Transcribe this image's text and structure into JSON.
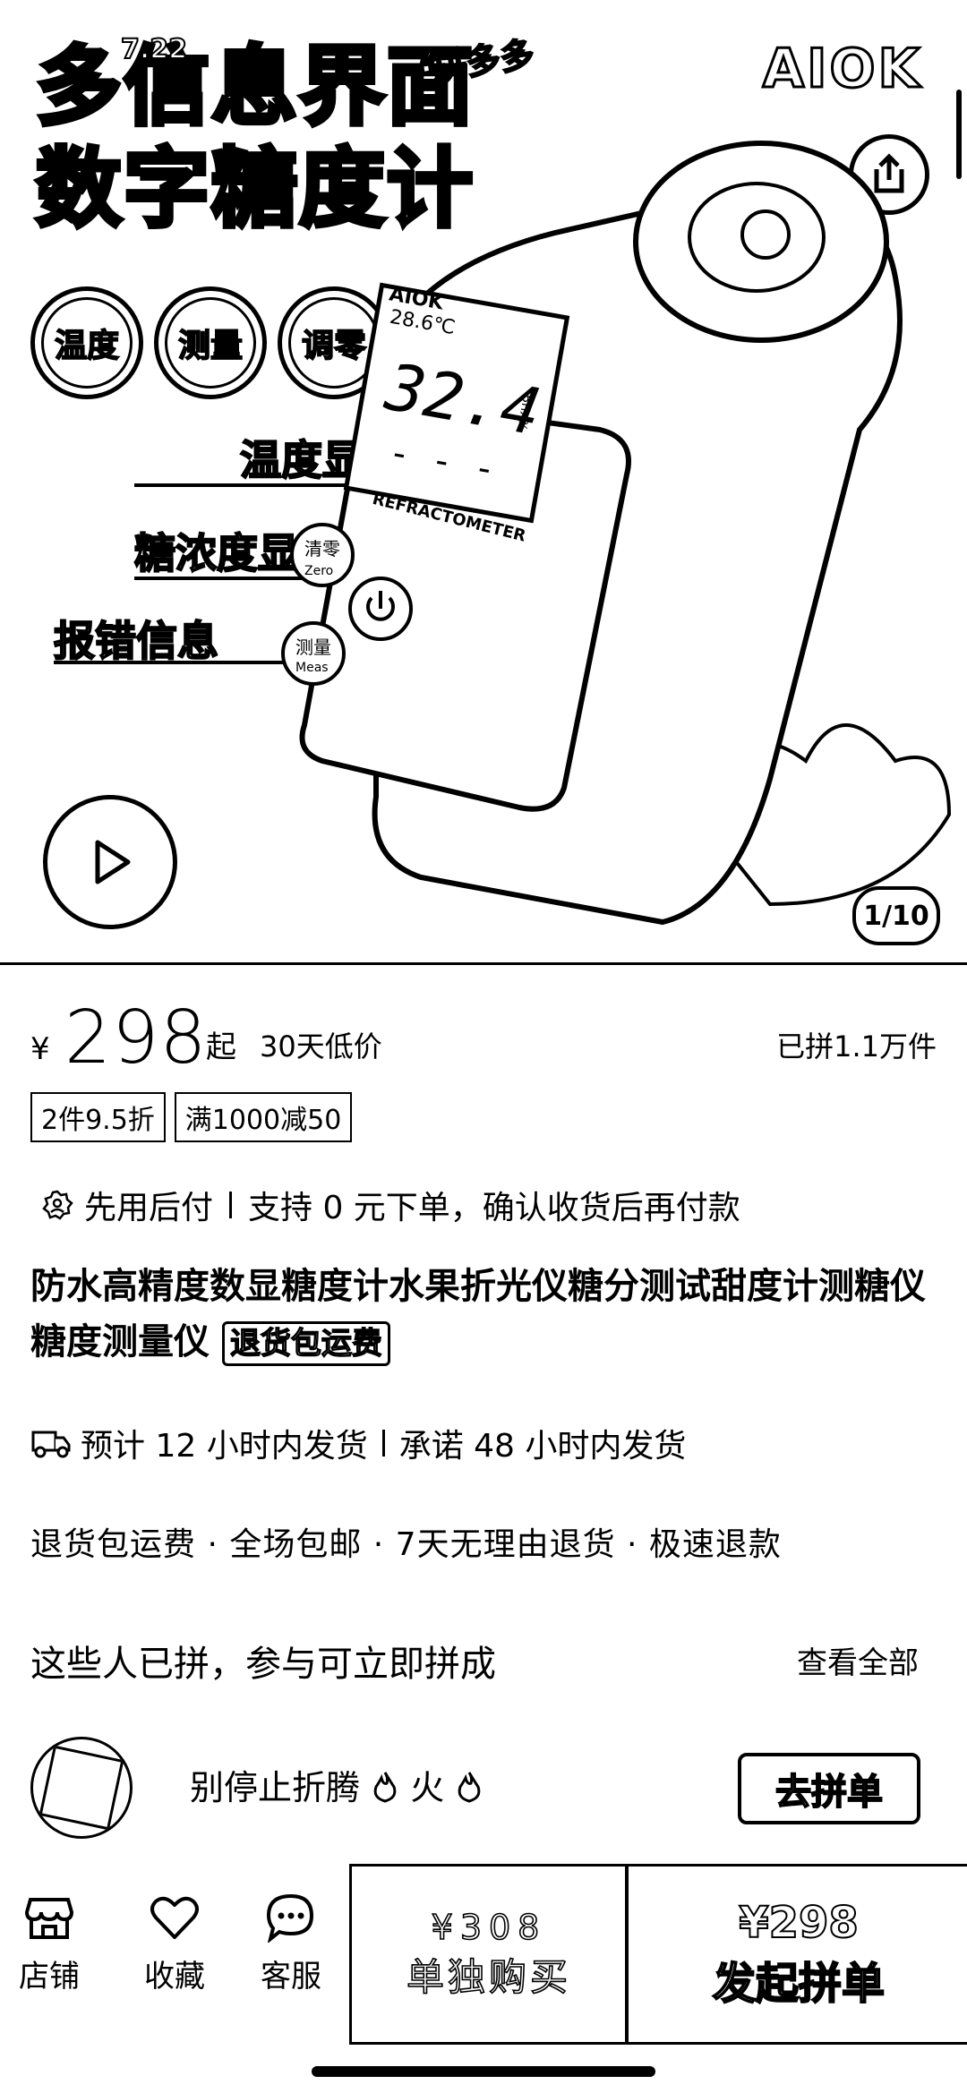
{
  "hero": {
    "title_line1": "多信息界面",
    "title_line2": "数字糖度计",
    "promo_date": "7.22",
    "platform_tag": "·拼多多",
    "brand": "AIOK",
    "features": [
      "温度",
      "测量",
      "调零"
    ],
    "callouts": [
      "温度显示",
      "糖浓度显示",
      "报错信息"
    ],
    "device": {
      "brand": "AIOK",
      "temp": "28.6℃",
      "reading": "32.4",
      "unit": "Brix%",
      "model": "REFRACTOMETER",
      "zero_label": "清零",
      "zero_sub": "Zero",
      "measure_label": "测量",
      "measure_sub": "Meas"
    },
    "pager": "1/10"
  },
  "price": {
    "currency": "¥",
    "amount": "298",
    "suffix": "起",
    "low_price_label": "30天低价",
    "sold": "已拼1.1万件"
  },
  "tags": [
    "2件9.5折",
    "满1000减50"
  ],
  "pay": {
    "title": "先用后付",
    "desc": "支持 0 元下单，确认收货后再付款"
  },
  "product": {
    "title": "防水高精度数显糖度计水果折光仪糖分测试甜度计测糖仪糖度测量仪",
    "badge": "退货包运费"
  },
  "shipping": {
    "estimate": "预计 12 小时内发货",
    "promise": "承诺 48 小时内发货"
  },
  "services": "退货包运费 · 全场包邮 · 7天无理由退货 · 极速退款",
  "group": {
    "title": "这些人已拼，参与可立即拼成",
    "view_all": "查看全部",
    "user_text": "别停止折腾",
    "user_text_2": "火",
    "join_label": "去拼单"
  },
  "bottom": {
    "store": "店铺",
    "favorite": "收藏",
    "service": "客服",
    "single_price": "¥308",
    "single_label": "单独购买",
    "group_price": "¥298",
    "group_label": "发起拼单"
  }
}
